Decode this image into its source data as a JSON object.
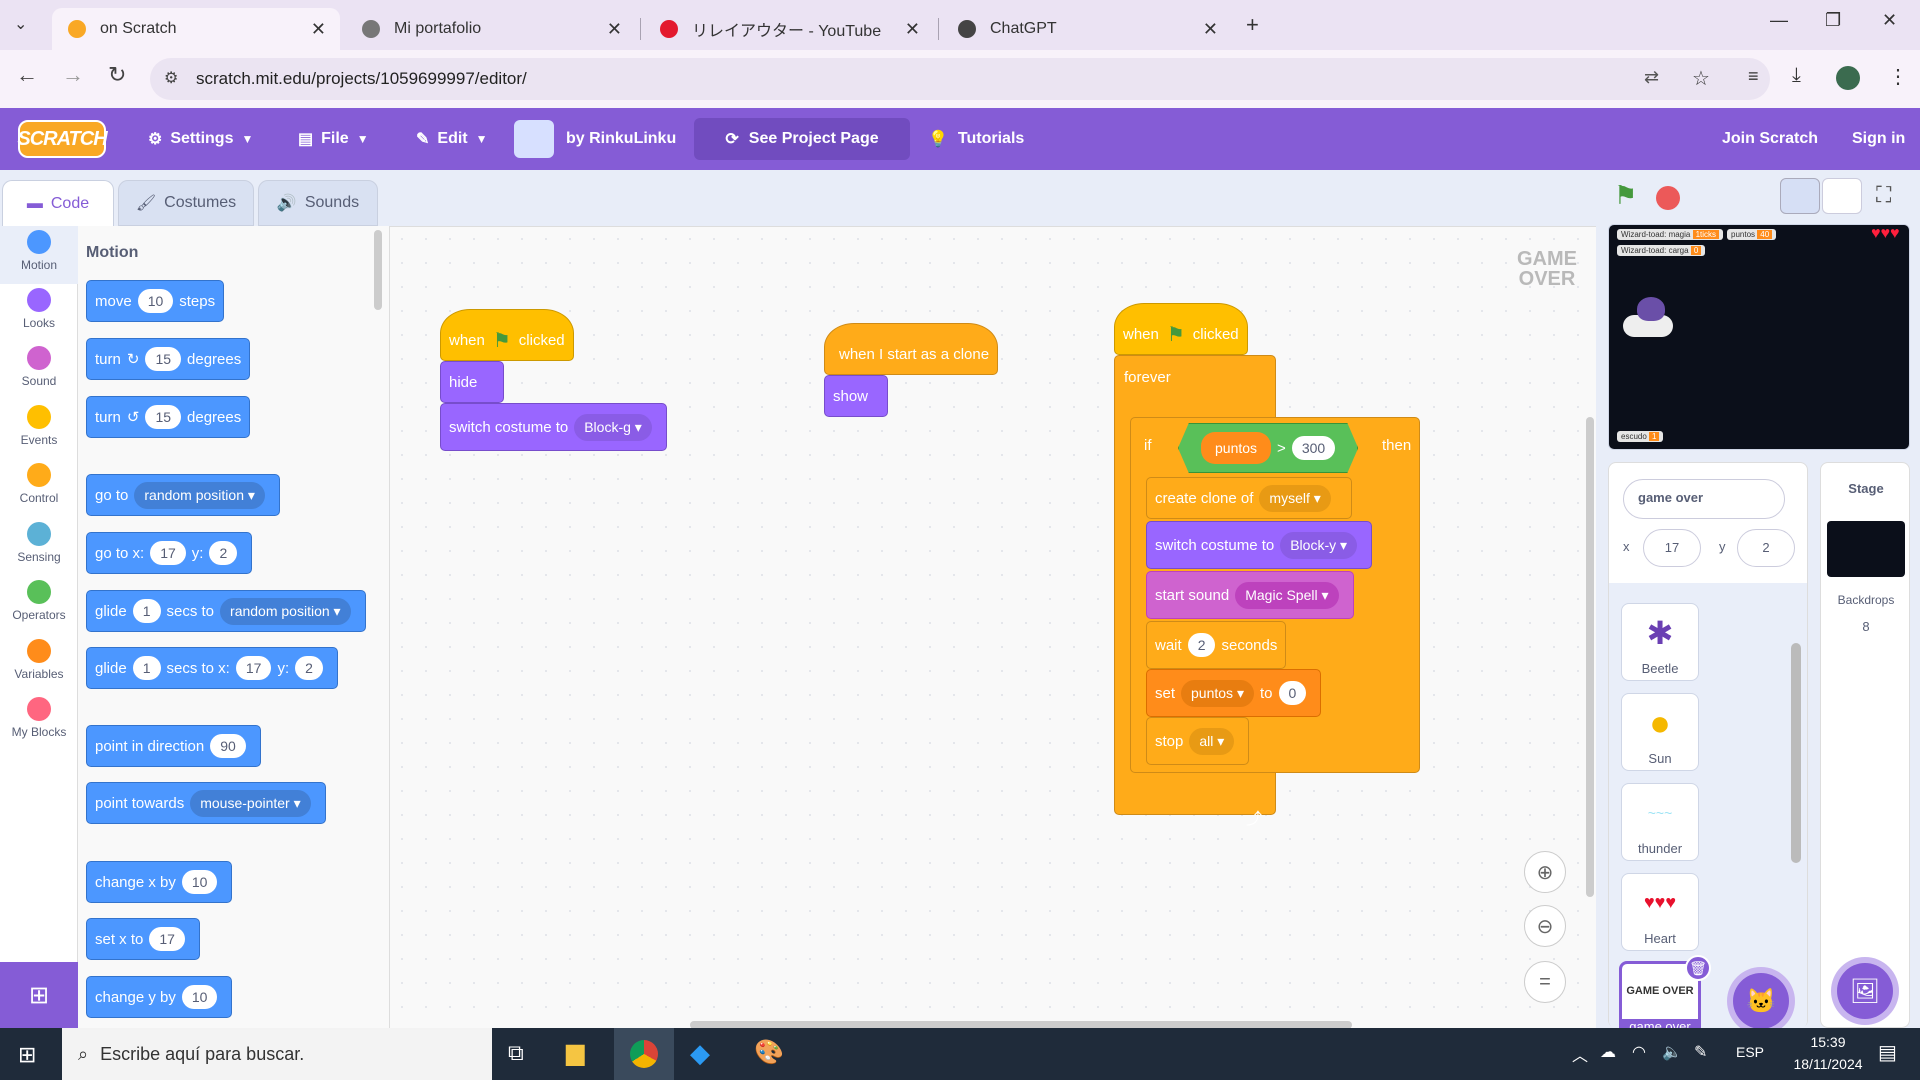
{
  "browser": {
    "tabs": [
      {
        "title": "on Scratch"
      },
      {
        "title": "Mi portafolio"
      },
      {
        "title": "リレイアウター - YouTube Mus"
      },
      {
        "title": "ChatGPT"
      }
    ],
    "url": "scratch.mit.edu/projects/1059699997/editor/"
  },
  "menu": {
    "logo": "SCRATCH",
    "settings": "Settings",
    "file": "File",
    "edit": "Edit",
    "author": "by RinkuLinku",
    "see_project": "See Project Page",
    "tutorials": "Tutorials",
    "join": "Join Scratch",
    "signin": "Sign in"
  },
  "editor_tabs": {
    "code": "Code",
    "costumes": "Costumes",
    "sounds": "Sounds"
  },
  "categories": [
    {
      "label": "Motion",
      "color": "#4c97ff"
    },
    {
      "label": "Looks",
      "color": "#9966ff"
    },
    {
      "label": "Sound",
      "color": "#cf63cf"
    },
    {
      "label": "Events",
      "color": "#ffbf00"
    },
    {
      "label": "Control",
      "color": "#ffab19"
    },
    {
      "label": "Sensing",
      "color": "#5cb1d6"
    },
    {
      "label": "Operators",
      "color": "#59c059"
    },
    {
      "label": "Variables",
      "color": "#ff8c1a"
    },
    {
      "label": "My Blocks",
      "color": "#ff6680"
    }
  ],
  "palette": {
    "heading": "Motion",
    "move": "move",
    "move_val": "10",
    "steps": "steps",
    "turn": "turn",
    "turn_val": "15",
    "degrees": "degrees",
    "goto": "go to",
    "random_position": "random position",
    "gotox": "go to x:",
    "x_val": "17",
    "y_label": "y:",
    "y_val": "2",
    "glide": "glide",
    "glide_val": "1",
    "secs_to": "secs to",
    "secs_to_x": "secs to x:",
    "point_dir": "point in direction",
    "dir_val": "90",
    "point_towards": "point towards",
    "mouse_pointer": "mouse-pointer",
    "change_x": "change x by",
    "set_x": "set x to",
    "change_y": "change y by",
    "ten": "10"
  },
  "scripts": {
    "when": "when",
    "clicked": "clicked",
    "hide": "hide",
    "switch_costume": "switch costume to",
    "costume_g": "Block-g",
    "start_clone": "when I start as a clone",
    "show": "show",
    "forever": "forever",
    "if": "if",
    "then": "then",
    "puntos": "puntos",
    "gt": ">",
    "v300": "300",
    "create_clone": "create clone of",
    "myself": "myself",
    "costume_y": "Block-y",
    "start_sound": "start sound",
    "magic_spell": "Magic Spell",
    "wait": "wait",
    "wait_val": "2",
    "seconds": "seconds",
    "set": "set",
    "to": "to",
    "zero": "0",
    "stop": "stop",
    "all": "all"
  },
  "stage": {
    "var1": "Wizard-toad: magia",
    "var1_val": "1ticks",
    "var2": "puntos",
    "var2_val": "40",
    "var3": "Wizard-toad: carga",
    "var3_val": "0",
    "var4": "escudo",
    "var4_val": "1",
    "game_over": "GAME OVER"
  },
  "sprite_info": {
    "name": "game over",
    "x_label": "x",
    "x_val": "17",
    "y_label": "y",
    "y_val": "2"
  },
  "sprites": [
    {
      "name": "Beetle"
    },
    {
      "name": "Sun"
    },
    {
      "name": "thunder"
    },
    {
      "name": "Heart"
    },
    {
      "name": "game over"
    }
  ],
  "stage_pane": {
    "title": "Stage",
    "backdrops": "Backdrops",
    "count": "8"
  },
  "taskbar": {
    "search": "Escribe aquí para buscar.",
    "lang": "ESP",
    "time": "15:39",
    "date": "18/11/2024"
  }
}
